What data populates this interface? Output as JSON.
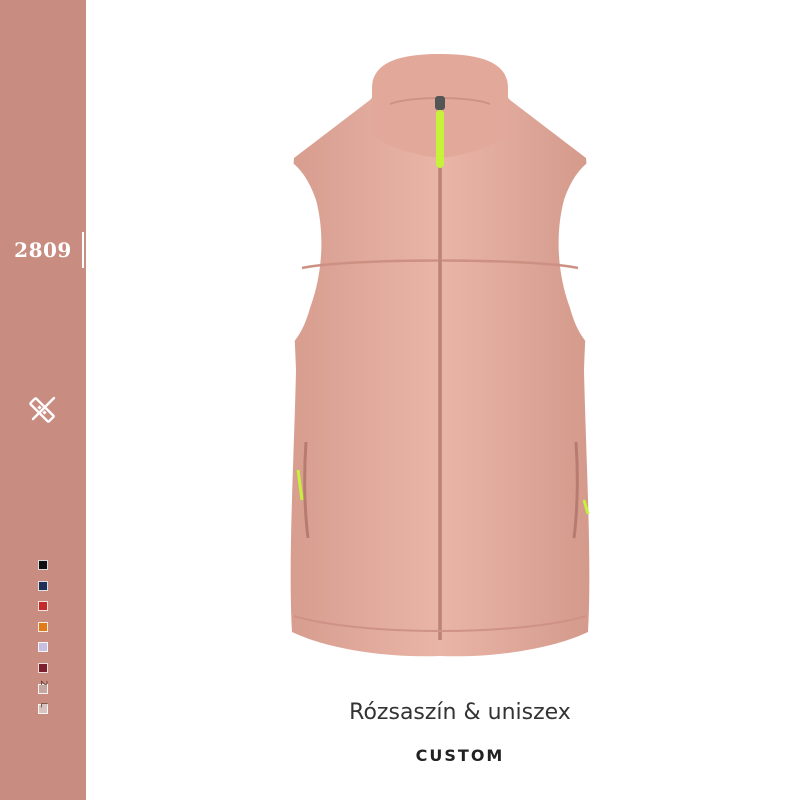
{
  "sidebar": {
    "code": "2809",
    "tool_icon": "pencil-ruler-icon",
    "swatches": [
      "#111111",
      "#1f2f55",
      "#c42a2a",
      "#e07b17",
      "#c8bfe0",
      "#7a1f2b",
      "#c8a6a0",
      "#d9c3bf"
    ],
    "size_letters": [
      "2",
      "L"
    ],
    "colors": {
      "background": "#c98c80",
      "text": "#ffffff"
    }
  },
  "product": {
    "name": "Rózsaszín & uniszex",
    "brand": "CUSTOM",
    "image": "pink-fleece-vest",
    "colors": {
      "fabric": "#e7b2a4",
      "accent": "#c6f23a"
    }
  }
}
